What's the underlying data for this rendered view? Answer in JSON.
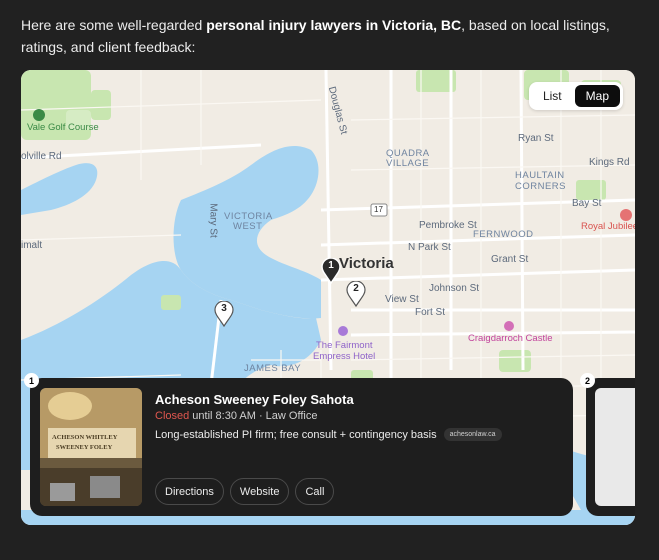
{
  "intro": {
    "before": "Here are some well-regarded ",
    "bold": "personal injury lawyers in Victoria, BC",
    "after": ", based on local listings, ratings, and client feedback:"
  },
  "view_toggle": {
    "list_label": "List",
    "map_label": "Map",
    "selected": "Map"
  },
  "map": {
    "labels": {
      "golf": "Vale Golf Course",
      "bolville": "olville Rd",
      "douglas": "Douglas St",
      "quadra1": "QUADRA",
      "quadra2": "VILLAGE",
      "ryan": "Ryan St",
      "kings": "Kings Rd",
      "haultain1": "HAULTAIN",
      "haultain2": "CORNERS",
      "mary": "Mary St",
      "vicwest1": "VICTORIA",
      "vicwest2": "WEST",
      "route": "17",
      "pembroke": "Pembroke St",
      "baystreet": "Bay St",
      "jubilee": "Royal Jubilee",
      "fernwood": "FERNWOOD",
      "npark": "N Park St",
      "imalt": "imalt",
      "victoria": "Victoria",
      "grant": "Grant St",
      "johnson": "Johnson St",
      "view": "View St",
      "fort": "Fort St",
      "craig": "Craigdarroch Castle",
      "fairmont1": "The Fairmont",
      "fairmont2": "Empress Hotel",
      "jamesbay": "JAMES BAY"
    },
    "pins": [
      "1",
      "2",
      "3"
    ]
  },
  "places": [
    {
      "number": "1",
      "name": "Acheson Sweeney Foley Sahota",
      "status": "Closed",
      "hours": " until 8:30 AM · Law Office",
      "description": "Long-established PI firm; free consult + contingency basis",
      "source": "achesonlaw.ca",
      "actions": {
        "directions": "Directions",
        "website": "Website",
        "call": "Call"
      },
      "sign_text": [
        "ACHESON WHITLEY",
        "SWEENEY FOLEY"
      ]
    },
    {
      "number": "2"
    }
  ],
  "colors": {
    "status_closed": "#e0574f",
    "water": "#a6d4f2",
    "park": "#c8e6b0",
    "land": "#f1ece4"
  }
}
